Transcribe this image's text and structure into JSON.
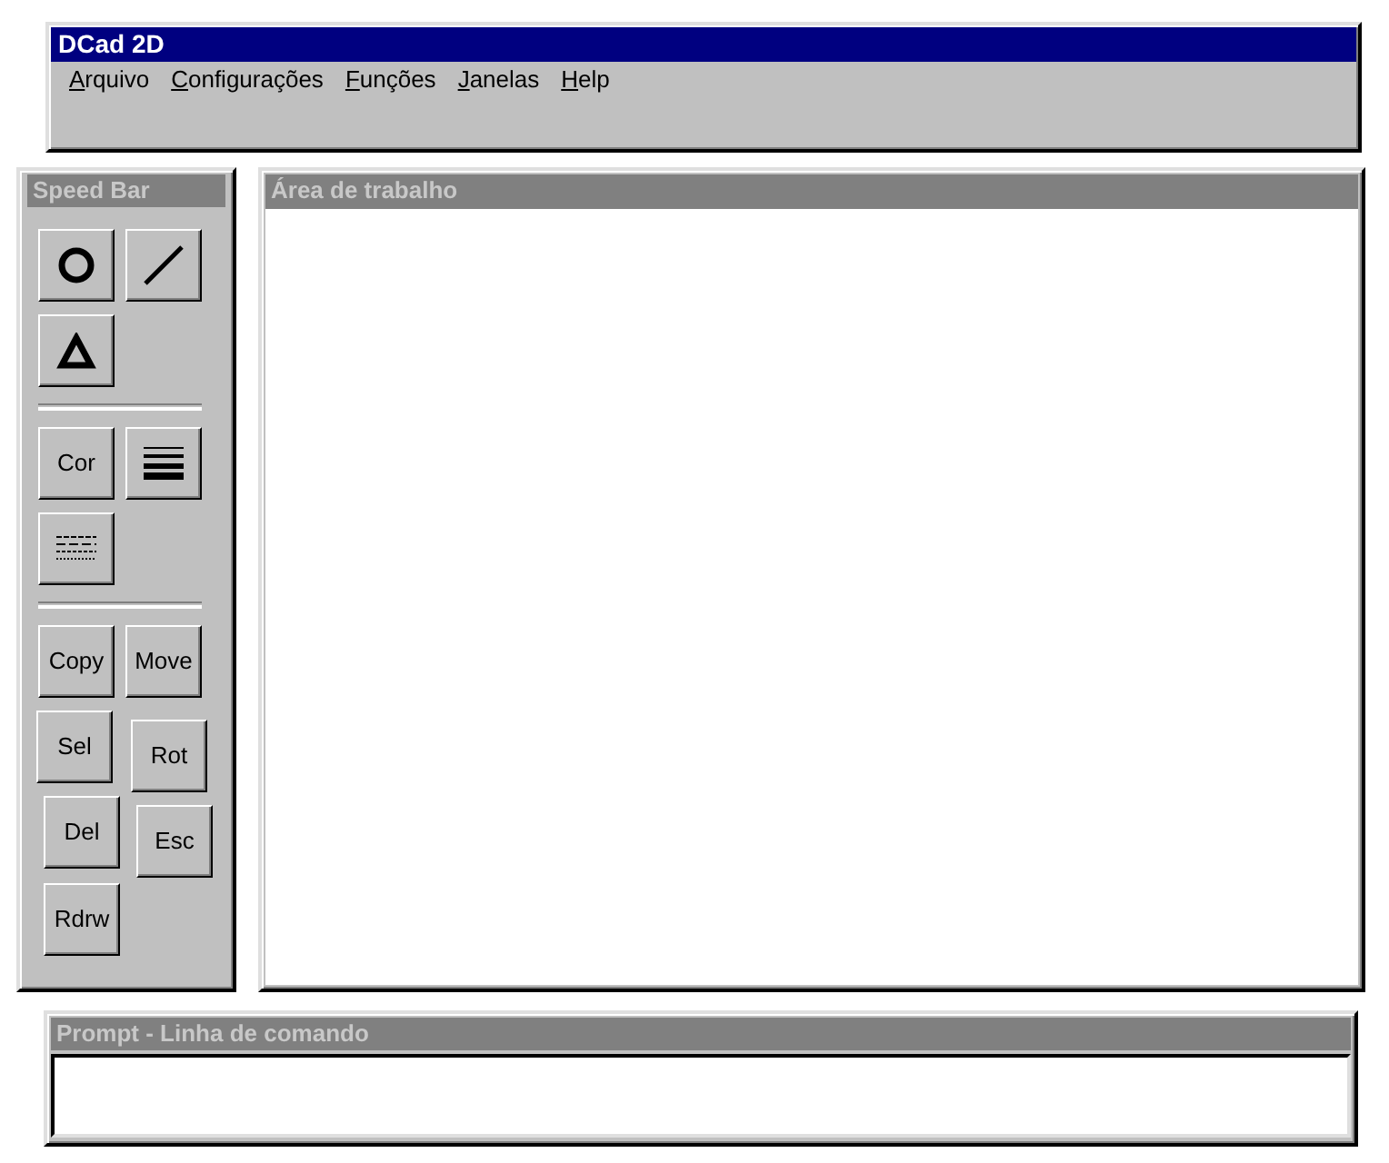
{
  "main_window": {
    "title": "DCad 2D",
    "menu": [
      {
        "label": "Arquivo"
      },
      {
        "label": "Configurações"
      },
      {
        "label": "Funções"
      },
      {
        "label": "Janelas"
      },
      {
        "label": "Help"
      }
    ]
  },
  "speed_bar": {
    "title": "Speed Bar",
    "groups": [
      [
        {
          "kind": "icon"
        },
        {
          "kind": "icon"
        },
        {
          "kind": "icon"
        }
      ],
      [
        {
          "kind": "text",
          "label": "Cor"
        },
        {
          "kind": "icon"
        },
        {
          "kind": "icon"
        }
      ],
      [
        {
          "kind": "text",
          "label": "Copy"
        },
        {
          "kind": "text",
          "label": "Move"
        },
        {
          "kind": "text",
          "label": "Sel"
        },
        {
          "kind": "text",
          "label": "Rot"
        },
        {
          "kind": "text",
          "label": "Del"
        },
        {
          "kind": "text",
          "label": "Esc"
        },
        {
          "kind": "text",
          "label": "Rdrw"
        }
      ]
    ]
  },
  "work_area": {
    "title": "Área de trabalho"
  },
  "prompt": {
    "title": "Prompt - Linha de comando"
  }
}
